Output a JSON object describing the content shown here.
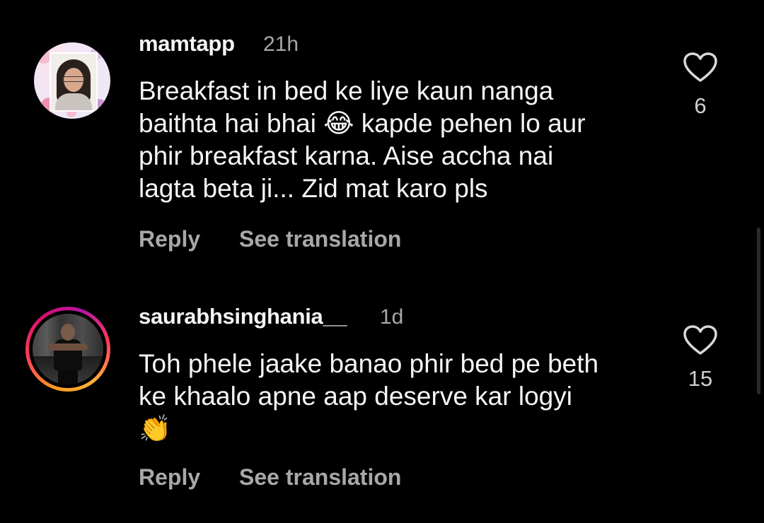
{
  "theme": {
    "background": "#000000",
    "text": "#f5f5f5",
    "muted": "#a8a8a8",
    "story_ring": [
      "#ff9a1f",
      "#ff3c5a",
      "#b515a8"
    ]
  },
  "comments": [
    {
      "username": "mamtapp",
      "time": "21h",
      "text": "Breakfast in bed ke liye kaun nanga\nbaithta hai bhai 😂 kapde pehen lo aur\nphir breakfast karna. Aise accha nai\nlagta beta ji... Zid mat karo pls",
      "reply_label": "Reply",
      "translate_label": "See translation",
      "like_icon": "heart-outline-icon",
      "likes": "6",
      "avatar": "profile-avatar"
    },
    {
      "username": "saurabhsinghania__",
      "time": "1d",
      "text": "Toh phele jaake banao phir bed pe beth\nke khaalo apne aap deserve kar logyi\n👏",
      "reply_label": "Reply",
      "translate_label": "See translation",
      "like_icon": "heart-outline-icon",
      "likes": "15",
      "avatar": "profile-avatar-story-ring"
    }
  ]
}
